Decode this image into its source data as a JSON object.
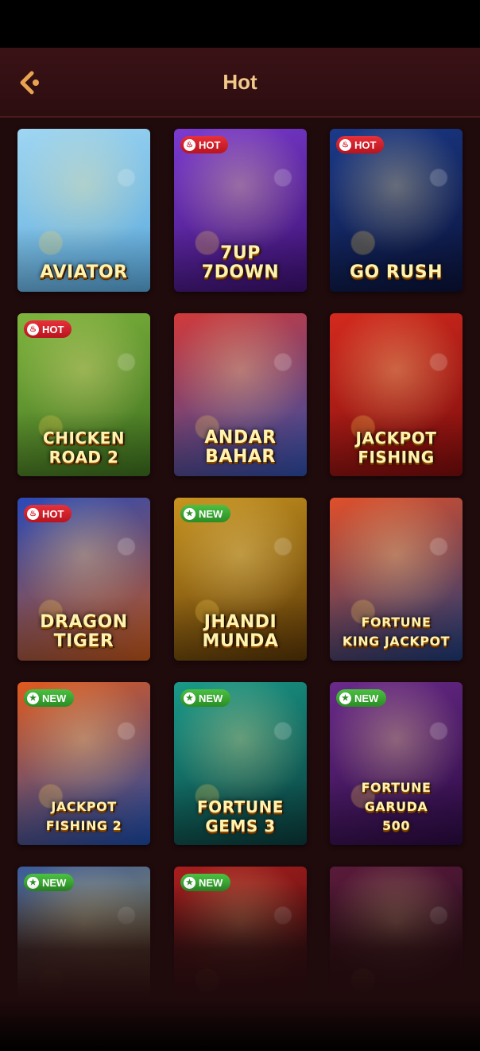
{
  "header": {
    "title": "Hot",
    "back_icon": "chevron-left-icon"
  },
  "games": [
    {
      "id": "aviator",
      "name": "AVIATOR",
      "badge": "",
      "colors": [
        "#9fd6f2",
        "#5aa9dd"
      ]
    },
    {
      "id": "7up-7down",
      "name": "7UP\n7DOWN",
      "badge": "HOT",
      "colors": [
        "#7b3bd0",
        "#3b1070"
      ]
    },
    {
      "id": "go-rush",
      "name": "GO RUSH",
      "badge": "HOT",
      "colors": [
        "#1b3a8a",
        "#0a1238"
      ]
    },
    {
      "id": "chicken-road-2",
      "name": "CHICKEN\nROAD 2",
      "badge": "HOT",
      "colors": [
        "#7fb53e",
        "#3c6e1e"
      ]
    },
    {
      "id": "andar-bahar",
      "name": "ANDAR\nBAHAR",
      "badge": "",
      "colors": [
        "#d23a3a",
        "#2c4da8"
      ]
    },
    {
      "id": "jackpot-fishing",
      "name": "JACKPOT\nFISHING",
      "badge": "",
      "colors": [
        "#d42a1e",
        "#7a0c0c"
      ]
    },
    {
      "id": "dragon-tiger",
      "name": "DRAGON\nTIGER",
      "badge": "HOT",
      "colors": [
        "#2a4ab8",
        "#c2561a"
      ]
    },
    {
      "id": "jhandi-munda",
      "name": "JHANDI\nMUNDA",
      "badge": "NEW",
      "colors": [
        "#c89420",
        "#5a3606"
      ]
    },
    {
      "id": "fortune-king-jackpot",
      "name": "FORTUNE\nKING JACKPOT",
      "badge": "",
      "colors": [
        "#e0502a",
        "#1c3a78"
      ]
    },
    {
      "id": "jackpot-fishing-2",
      "name": "JACKPOT\nFISHING 2",
      "badge": "NEW",
      "colors": [
        "#e05a1e",
        "#1a4aa8"
      ]
    },
    {
      "id": "fortune-gems-3",
      "name": "FORTUNE\nGEMS 3",
      "badge": "NEW",
      "colors": [
        "#1a9a8a",
        "#0a3a3a"
      ]
    },
    {
      "id": "fortune-garuda-500",
      "name": "FORTUNE GARUDA\n500",
      "badge": "NEW",
      "colors": [
        "#6a2a8a",
        "#2a0a40"
      ]
    },
    {
      "id": "game-13",
      "name": "",
      "badge": "NEW",
      "colors": [
        "#3a5a9a",
        "#b8a23a"
      ]
    },
    {
      "id": "game-14",
      "name": "",
      "badge": "NEW",
      "colors": [
        "#a81e1e",
        "#3a0a0a"
      ]
    },
    {
      "id": "game-15",
      "name": "",
      "badge": "",
      "colors": [
        "#5a1a3a",
        "#1a0a1a"
      ]
    }
  ]
}
